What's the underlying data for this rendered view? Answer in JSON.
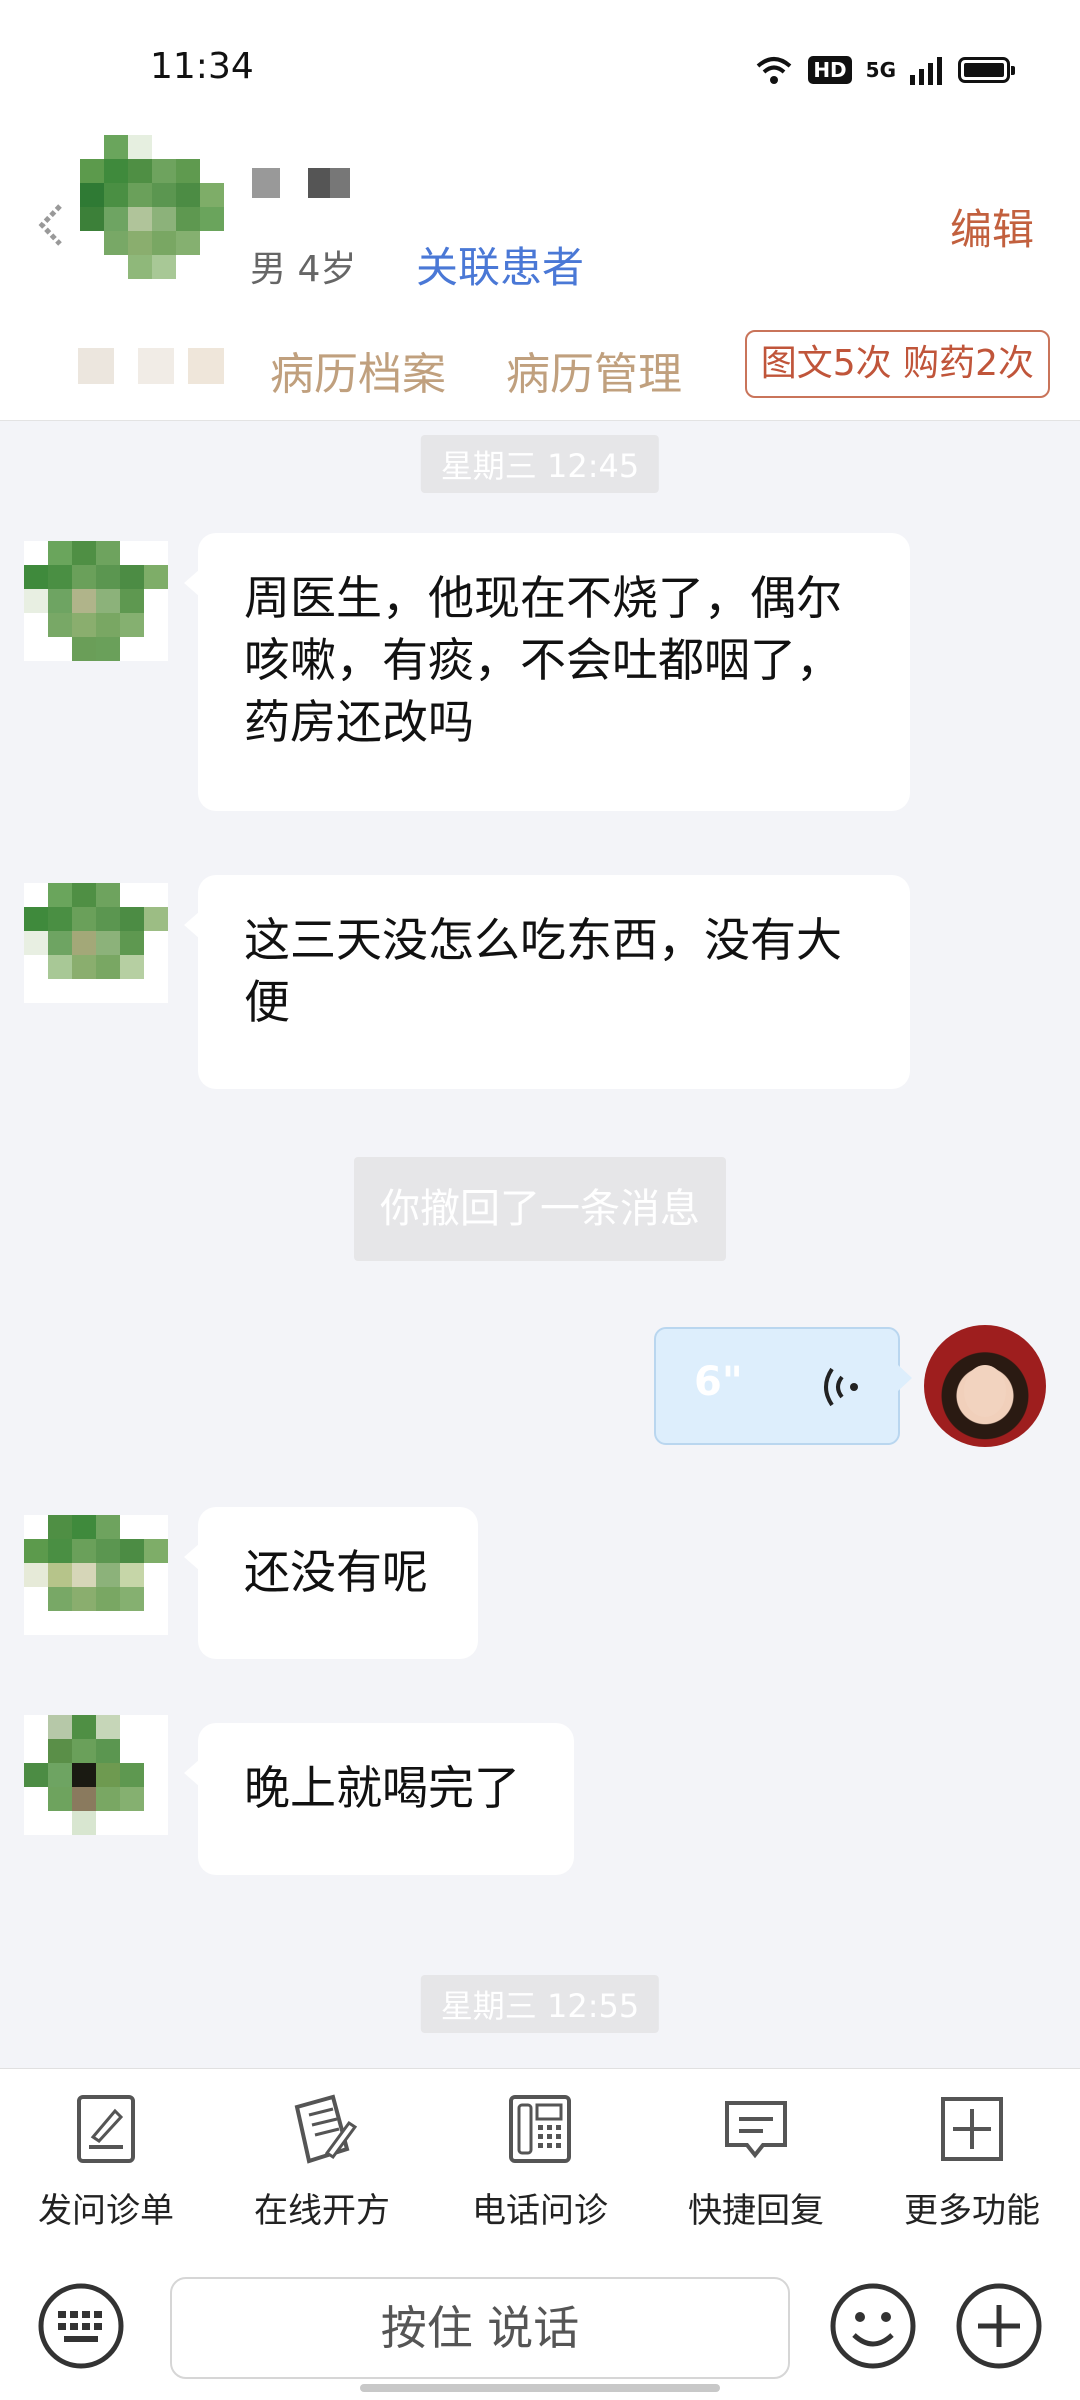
{
  "status": {
    "time": "11:34",
    "hd": "HD",
    "network": "5G"
  },
  "patient": {
    "meta": "男 4岁",
    "link_label": "关联患者",
    "edit_label": "编辑"
  },
  "tabs": [
    {
      "label": "病历档案"
    },
    {
      "label": "病历管理"
    }
  ],
  "service_badge": "图文5次 购药2次",
  "messages": [
    {
      "type": "timestamp",
      "text": "星期三 12:45"
    },
    {
      "type": "incoming",
      "text": "周医生，他现在不烧了，偶尔咳嗽，有痰，不会吐都咽了，药房还改吗"
    },
    {
      "type": "incoming",
      "text": "这三天没怎么吃东西，没有大便"
    },
    {
      "type": "recall",
      "text": "你撤回了一条消息"
    },
    {
      "type": "outgoing-voice",
      "duration": "6\""
    },
    {
      "type": "incoming",
      "text": "还没有呢"
    },
    {
      "type": "incoming",
      "text": "晚上就喝完了"
    },
    {
      "type": "timestamp",
      "text": "星期三 12:55"
    }
  ],
  "toolbar": [
    {
      "label": "发问诊单",
      "icon": "form-icon"
    },
    {
      "label": "在线开方",
      "icon": "prescription-icon"
    },
    {
      "label": "电话问诊",
      "icon": "phone-icon"
    },
    {
      "label": "快捷回复",
      "icon": "message-icon"
    },
    {
      "label": "更多功能",
      "icon": "plus-square-icon"
    }
  ],
  "input": {
    "voice_button_label": "按住 说话"
  },
  "colors": {
    "accent_blue": "#4a78d6",
    "edit_orange": "#c2603e",
    "tab_tan": "#c0a07e",
    "badge_red": "#c0553a"
  }
}
